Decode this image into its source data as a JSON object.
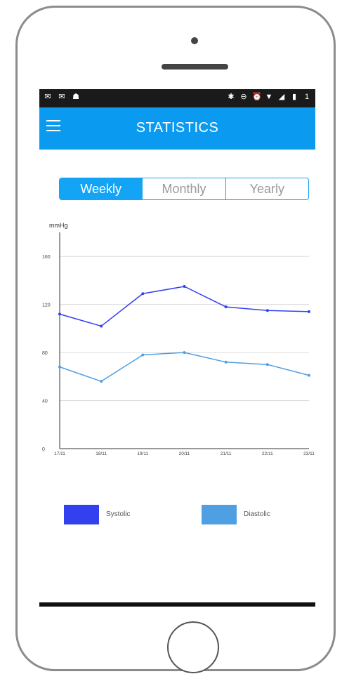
{
  "status_bar": {
    "left_icons": [
      "mail-icon",
      "gmail-icon",
      "android-icon"
    ],
    "right_icons": [
      "bluetooth-icon",
      "dnd-icon",
      "alarm-icon",
      "wifi-icon",
      "signal-icon",
      "battery-icon"
    ],
    "time_fragment": "1"
  },
  "app_bar": {
    "title": "STATISTICS"
  },
  "tabs": [
    {
      "label": "Weekly",
      "active": true
    },
    {
      "label": "Monthly",
      "active": false
    },
    {
      "label": "Yearly",
      "active": false
    }
  ],
  "colors": {
    "accent": "#0a9aef",
    "tab_accent": "#14a4f5",
    "systolic": "#3340f0",
    "diastolic": "#4f9fe3"
  },
  "chart_data": {
    "type": "line",
    "ylabel": "mmHg",
    "x": [
      "17/11",
      "18/11",
      "19/11",
      "20/11",
      "21/11",
      "22/11",
      "23/11"
    ],
    "yticks": [
      0,
      40,
      80,
      120,
      160
    ],
    "ylim": [
      0,
      180
    ],
    "grid": true,
    "legend": "bottom",
    "series": [
      {
        "name": "Systolic",
        "color": "#3340f0",
        "values": [
          112,
          102,
          129,
          135,
          118,
          115,
          114
        ]
      },
      {
        "name": "Diastolic",
        "color": "#4f9fe3",
        "values": [
          68,
          56,
          78,
          80,
          72,
          70,
          61
        ]
      }
    ]
  }
}
